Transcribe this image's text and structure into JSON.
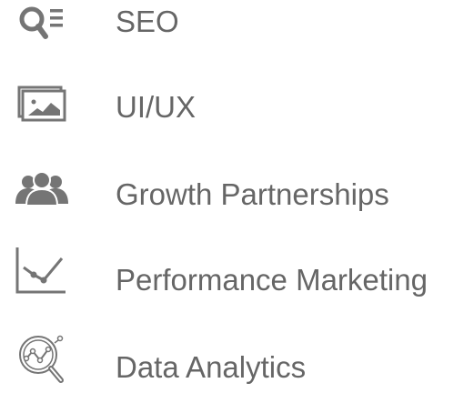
{
  "services": [
    {
      "label": "SEO",
      "icon": "seo-search-icon"
    },
    {
      "label": "UI/UX",
      "icon": "image-gallery-icon"
    },
    {
      "label": "Growth Partnerships",
      "icon": "people-group-icon"
    },
    {
      "label": "Performance Marketing",
      "icon": "line-chart-icon"
    },
    {
      "label": "Data Analytics",
      "icon": "analytics-magnifier-icon"
    }
  ],
  "colors": {
    "icon": "#757575",
    "text": "#666666",
    "background": "#ffffff"
  }
}
